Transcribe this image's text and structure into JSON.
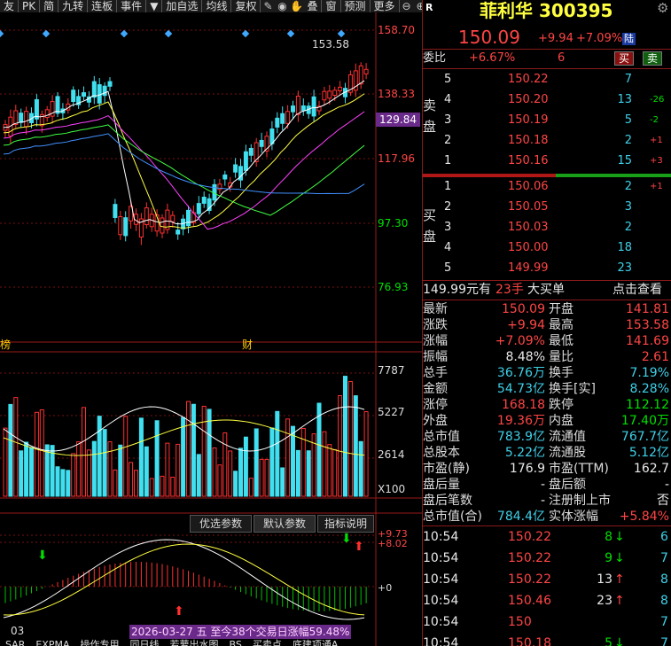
{
  "toolbar": {
    "items": [
      "友",
      "PK",
      "简",
      "九转",
      "连板",
      "事件",
      "▼",
      "加自选",
      "均线",
      "复权",
      "叠",
      "窗",
      "预测",
      "更多"
    ]
  },
  "chart": {
    "price_axis": [
      "158.70",
      "138.33",
      "117.96",
      "97.30",
      "76.93"
    ],
    "price_marker": "129.84",
    "high_label": "153.58",
    "bottom_left_label": "榜",
    "bottom_mid_label": "财",
    "volume_axis": [
      "7787",
      "5227",
      "2614"
    ],
    "volume_unit": "X100",
    "indicator_axis": [
      "+9.73",
      "+8.02",
      "+0"
    ],
    "tabs": [
      "优选参数",
      "默认参数",
      "指标说明"
    ],
    "date_label": "03",
    "status_text": "2026-03-27 五 至今38个交易日涨幅59.48%",
    "bottom_tabs": [
      "SAR",
      "EXPMA",
      "操作专用",
      "同日线",
      "若萝出水图",
      "BS",
      "买卖点",
      "底建项通A"
    ]
  },
  "stock": {
    "name": "菲利华",
    "code": "300395",
    "price": "150.09",
    "change": "+9.94",
    "pct": "+7.09%",
    "tag": "陆",
    "r_label": "R"
  },
  "order_book": {
    "weibi_label": "委比",
    "weibi_value": "+6.67%",
    "weibi_count": "6",
    "buy_btn": "买",
    "sell_btn": "卖",
    "sell_side_label": [
      "卖",
      "盘"
    ],
    "buy_side_label": [
      "买",
      "盘"
    ],
    "sells": [
      {
        "level": "5",
        "price": "150.22",
        "vol": "7",
        "chg": ""
      },
      {
        "level": "4",
        "price": "150.20",
        "vol": "13",
        "chg": "-26"
      },
      {
        "level": "3",
        "price": "150.19",
        "vol": "5",
        "chg": "-2"
      },
      {
        "level": "2",
        "price": "150.18",
        "vol": "2",
        "chg": "+1"
      },
      {
        "level": "1",
        "price": "150.16",
        "vol": "15",
        "chg": "+3"
      }
    ],
    "buys": [
      {
        "level": "1",
        "price": "150.06",
        "vol": "2",
        "chg": "+1"
      },
      {
        "level": "2",
        "price": "150.05",
        "vol": "3",
        "chg": ""
      },
      {
        "level": "3",
        "price": "150.03",
        "vol": "2",
        "chg": ""
      },
      {
        "level": "4",
        "price": "150.00",
        "vol": "18",
        "chg": ""
      },
      {
        "level": "5",
        "price": "149.99",
        "vol": "23",
        "chg": ""
      }
    ],
    "big_order": {
      "price": "149.99元有",
      "vol": "23手",
      "label": "大买单",
      "link": "点击查看"
    }
  },
  "quote": [
    {
      "l1": "最新",
      "v1": "150.09",
      "c1": "red",
      "l2": "开盘",
      "v2": "141.81",
      "c2": "red"
    },
    {
      "l1": "涨跌",
      "v1": "+9.94",
      "c1": "red",
      "l2": "最高",
      "v2": "153.58",
      "c2": "red"
    },
    {
      "l1": "涨幅",
      "v1": "+7.09%",
      "c1": "red",
      "l2": "最低",
      "v2": "141.69",
      "c2": "red"
    },
    {
      "l1": "振幅",
      "v1": "8.48%",
      "c1": "white",
      "l2": "量比",
      "v2": "2.61",
      "c2": "red"
    },
    {
      "l1": "总手",
      "v1": "36.76万",
      "c1": "cyan",
      "l2": "换手",
      "v2": "7.19%",
      "c2": "cyan"
    },
    {
      "l1": "金额",
      "v1": "54.73亿",
      "c1": "cyan",
      "l2": "换手[实]",
      "v2": "8.28%",
      "c2": "cyan"
    },
    {
      "l1": "涨停",
      "v1": "168.18",
      "c1": "red",
      "l2": "跌停",
      "v2": "112.12",
      "c2": "green"
    },
    {
      "l1": "外盘",
      "v1": "19.36万",
      "c1": "red",
      "l2": "内盘",
      "v2": "17.40万",
      "c2": "green"
    },
    {
      "l1": "总市值",
      "v1": "783.9亿",
      "c1": "cyan",
      "l2": "流通值",
      "v2": "767.7亿",
      "c2": "cyan"
    },
    {
      "l1": "总股本",
      "v1": "5.22亿",
      "c1": "cyan",
      "l2": "流通股",
      "v2": "5.12亿",
      "c2": "cyan"
    },
    {
      "l1": "市盈(静)",
      "v1": "176.9",
      "c1": "white",
      "l2": "市盈(TTM)",
      "v2": "162.7",
      "c2": "white"
    },
    {
      "l1": "盘后量",
      "v1": "-",
      "c1": "white",
      "l2": "盘后额",
      "v2": "-",
      "c2": "white"
    },
    {
      "l1": "盘后笔数",
      "v1": "-",
      "c1": "white",
      "l2": "注册制上市",
      "v2": "否",
      "c2": "white"
    },
    {
      "l1": "总市值(合)",
      "v1": "784.4亿",
      "c1": "cyan",
      "l2": "实体涨幅",
      "v2": "+5.84%",
      "c2": "red"
    }
  ],
  "ticks": [
    {
      "time": "10:54",
      "price": "150.22",
      "vol": "8",
      "dir": "down",
      "n": "6"
    },
    {
      "time": "10:54",
      "price": "150.22",
      "vol": "9",
      "dir": "down",
      "n": "7"
    },
    {
      "time": "10:54",
      "price": "150.22",
      "vol": "13",
      "dir": "up",
      "n": "8"
    },
    {
      "time": "10:54",
      "price": "150.46",
      "vol": "23",
      "dir": "up",
      "n": "8"
    },
    {
      "time": "10:54",
      "price": "150",
      "vol": "",
      "dir": "",
      "n": "7"
    },
    {
      "time": "10:54",
      "price": "150.18",
      "vol": "5",
      "dir": "down",
      "n": "7"
    }
  ],
  "colors": {
    "up": "#ff4545",
    "down": "#00e000",
    "cyan": "#3fd0e8",
    "bg": "#000000"
  }
}
